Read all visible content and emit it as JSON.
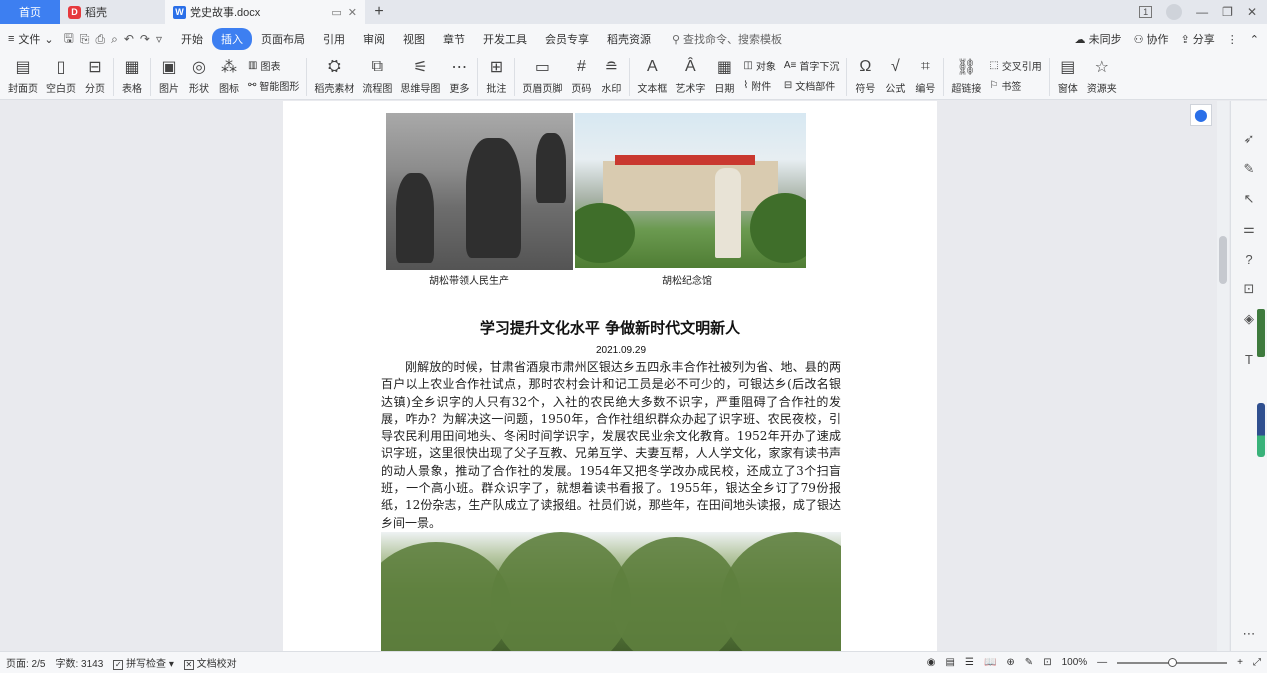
{
  "tabs": {
    "home": "首页",
    "daoke": "稻壳",
    "document": "党史故事.docx",
    "add_label": "+"
  },
  "window": {
    "badge": "1"
  },
  "menu": {
    "file": "文件",
    "tabs": [
      "开始",
      "插入",
      "页面布局",
      "引用",
      "审阅",
      "视图",
      "章节",
      "开发工具",
      "会员专享",
      "稻壳资源"
    ],
    "active_tab": "插入",
    "search_placeholder": "查找命令、搜索模板",
    "sync": "未同步",
    "collab": "协作",
    "share": "分享"
  },
  "ribbon": {
    "cover": "封面页",
    "blank": "空白页",
    "pagebreak": "分页",
    "table": "表格",
    "picture": "图片",
    "shape": "形状",
    "icon": "图标",
    "chart": "图表",
    "smartart": "智能图形",
    "daoke_material": "稻壳素材",
    "flowchart": "流程图",
    "mindmap": "思维导图",
    "more": "更多",
    "comment": "批注",
    "header_footer": "页眉页脚",
    "page_number": "页码",
    "watermark": "水印",
    "textbox": "文本框",
    "wordart": "艺术字",
    "date": "日期",
    "object": "对象",
    "attachment": "附件",
    "dropcap": "首字下沉",
    "doc_parts": "文档部件",
    "symbol": "符号",
    "formula": "公式",
    "numbering": "编号",
    "hyperlink": "超链接",
    "crossref": "交叉引用",
    "bookmark": "书签",
    "form": "窗体",
    "resources": "资源夹"
  },
  "document": {
    "caption1": "胡松带领人民生产",
    "caption2": "胡松纪念馆",
    "title": "学习提升文化水平  争做新时代文明新人",
    "date": "2021.09.29",
    "body": "刚解放的时候，甘肃省酒泉市肃州区银达乡五四永丰合作社被列为省、地、县的两百户以上农业合作社试点，那时农村会计和记工员是必不可少的，可银达乡(后改名银达镇)全乡识字的人只有32个，入社的农民绝大多数不识字，严重阻碍了合作社的发展，咋办？为解决这一问题，1950年，合作社组织群众办起了识字班、农民夜校，引导农民利用田间地头、冬闲时间学识字，发展农民业余文化教育。1952年开办了速成识字班，这里很快出现了父子互教、兄弟互学、夫妻互帮，人人学文化，家家有读书声的动人景象，推动了合作社的发展。1954年又把冬学改办成民校，还成立了3个扫盲班，一个高小班。群众识字了，就想着读书看报了。1955年，银达全乡订了79份报纸，12份杂志，生产队成立了读报组。社员们说，那些年，在田间地头读报，成了银达乡间一景。"
  },
  "status": {
    "page": "页面: 2/5",
    "words": "字数: 3143",
    "spell": "拼写检查",
    "proof": "文档校对",
    "zoom": "100%",
    "zoom_level": 0.5
  }
}
